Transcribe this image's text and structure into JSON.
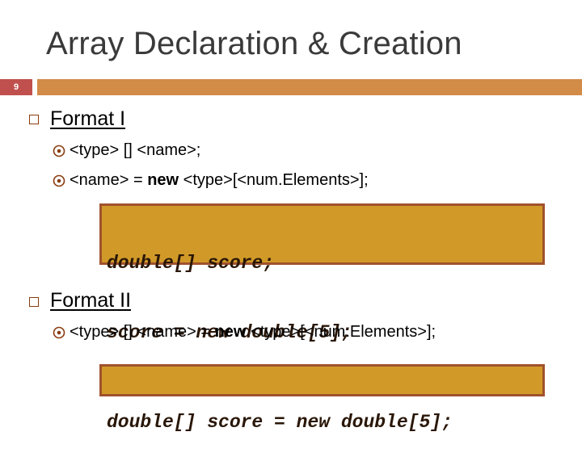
{
  "slide": {
    "title": "Array Declaration & Creation",
    "number": "9",
    "colors": {
      "accent_bar": "#d38b48",
      "number_box": "#c0504d",
      "code_bg": "#d19a28",
      "code_border": "#a0522d"
    }
  },
  "format1": {
    "heading": "Format I",
    "items": [
      {
        "pre": "<type> [] <name>;",
        "kw": "",
        "post": ""
      },
      {
        "pre": "<name> = ",
        "kw": "new",
        "post": " <type>[<num.Elements>];"
      }
    ],
    "code": [
      "double[] score;",
      "score = new double[5];"
    ]
  },
  "format2": {
    "heading": "Format II",
    "items": [
      {
        "pre": "<type> [] <name> = ",
        "kw": "new",
        "post": " <type>[<num.Elements>];"
      }
    ],
    "code": [
      "double[] score = new double[5];"
    ]
  },
  "icons": {
    "main_bullet": "hollow-square-icon",
    "sub_bullet": "circled-dot-icon"
  }
}
